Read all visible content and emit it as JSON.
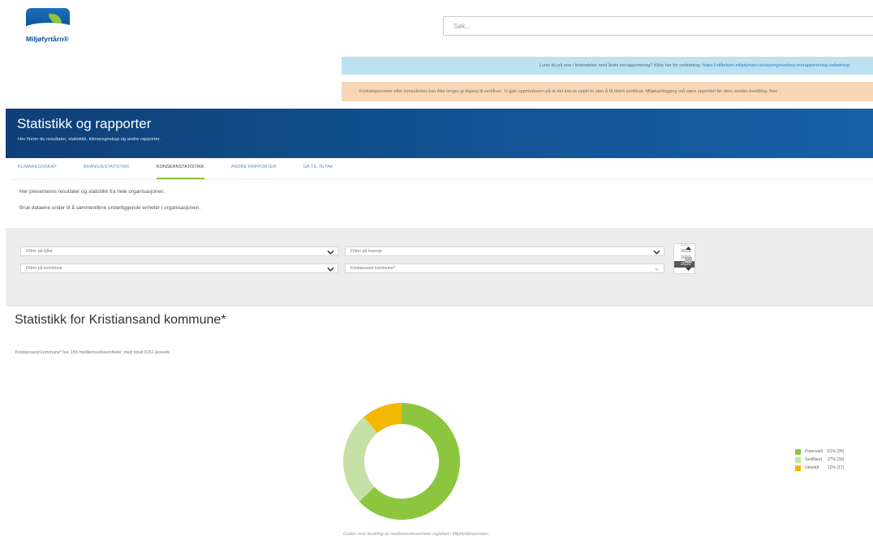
{
  "header": {
    "logo_text": "Miljøfyrtårn®",
    "search_placeholder": "Søk..."
  },
  "banners": {
    "info_text": "Lurer du på noe i forbindelse med årets innrapportering? Klikk her for veiledning:",
    "info_link": "https://stiftelsen.miljofyrtarn.no/styringsverktoy-innrapportering-veiledning",
    "warning_text": "Kontaktpersoner eller konsulenter kan ikke lenger gi tilgang til sertifiser. Vi gjør oppmerksom på at det kan ta opptil to uker å få tildelt sertifisat. Miljøkartlegging må være opprettet før dere sender bestilling. Bes"
  },
  "hero": {
    "title": "Statistikk og rapporter",
    "subtitle": "Her finner du resultater, statistikk, klimaregnskap og andre rapporter."
  },
  "tabs": [
    {
      "label": "KLIMAREGNSKAP",
      "active": false
    },
    {
      "label": "BRANSJESTATISTIKK",
      "active": false
    },
    {
      "label": "KONSERNSTATISTIKK",
      "active": true
    },
    {
      "label": "ANDRE RAPPORTER",
      "active": false
    },
    {
      "label": "GÅ TIL TILTAK",
      "active": false
    }
  ],
  "intro": {
    "line1": "Her presenteres resultater og statistikk fra hele organisasjonen.",
    "line2": "Bruk dataene under til å sammenlikne underliggende enheter i organisasjonen."
  },
  "filters": {
    "fylke": "Filtrer på fylke",
    "kommune": "Filtrer på kommune",
    "bransje": "Filtrer på bransje",
    "organisation": "Kristiansand kommune*",
    "years": [
      "2017",
      "2018",
      "2019",
      "2020"
    ],
    "selected_year": "2020"
  },
  "stats": {
    "title": "Statistikk for Kristiansand kommune*",
    "summary": "Kristiansand kommune* har 155 medlemsvirksomheter, med totalt 9151 årsverk",
    "caption": "Grafen viser fordeling av medlemsvirksomheter registrert i Miljøfyrtårnportalen"
  },
  "chart_data": {
    "type": "pie",
    "title": "",
    "series": [
      {
        "name": "Potensiell",
        "percent": 61,
        "count": 95,
        "label": "61% (95)",
        "color": "#8cc63f"
      },
      {
        "name": "Sertifisert",
        "percent": 27,
        "count": 39,
        "label": "27% (39)",
        "color": "#c5e0a5"
      },
      {
        "name": "Utmeldt",
        "percent": 12,
        "count": 17,
        "label": "12% (17)",
        "color": "#f4b800"
      }
    ]
  }
}
